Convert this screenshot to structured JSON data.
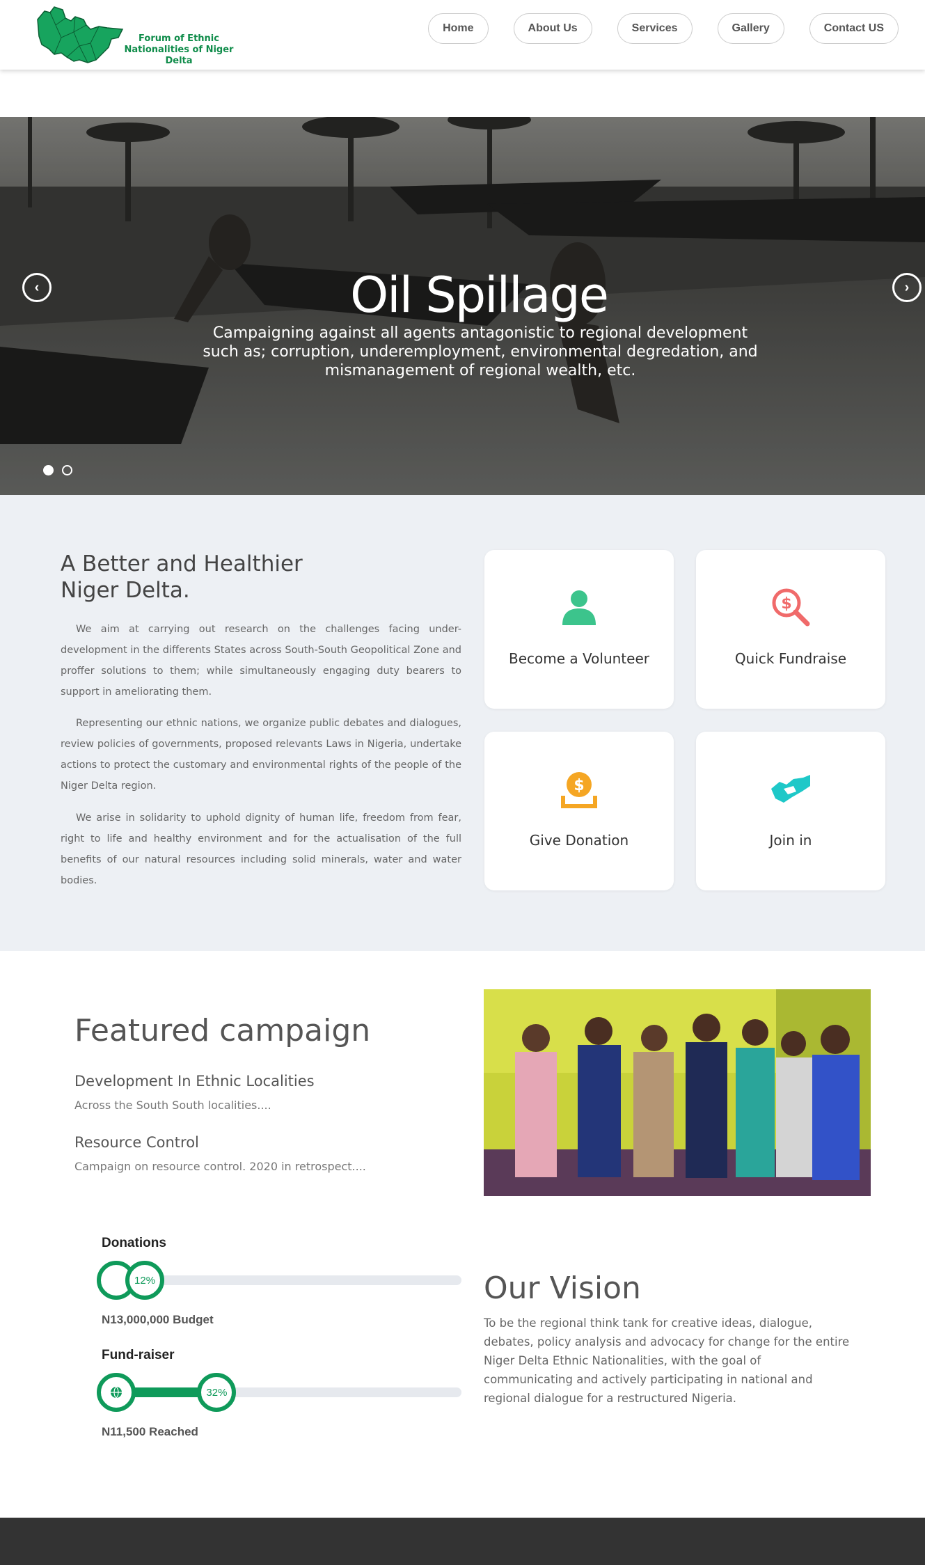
{
  "header": {
    "logo_line1": "Forum of Ethnic",
    "logo_line2": "Nationalities of Niger Delta",
    "nav": [
      "Home",
      "About Us",
      "Services",
      "Gallery",
      "Contact US"
    ]
  },
  "hero": {
    "title": "Oil Spillage",
    "subtitle": "Campaigning against all agents antagonistic to regional development such as; corruption, underemployment, environmental degredation, and mismanagement of regional wealth, etc.",
    "slide_count": 2,
    "active_slide": 1
  },
  "about": {
    "title": "A Better and Healthier Niger Delta.",
    "paragraphs": [
      "We aim at carrying out research on the challenges facing under-development in the differents States across South-South Geopolitical Zone and proffer solutions to them; while simultaneously engaging duty bearers to support in ameliorating them.",
      "Representing our ethnic nations, we organize public debates and dialogues, review policies of governments, proposed relevants Laws in Nigeria, undertake actions to protect the customary and environmental rights of the people of the Niger Delta region.",
      "We arise in solidarity to uphold dignity of human life, freedom from fear, right to life and healthy environment and for the actualisation of the full benefits of our natural resources including solid minerals, water and water bodies."
    ],
    "cards": [
      {
        "label": "Become a Volunteer",
        "icon": "user-icon"
      },
      {
        "label": "Quick Fundraise",
        "icon": "money-search-icon"
      },
      {
        "label": "Give Donation",
        "icon": "donation-icon"
      },
      {
        "label": "Join in",
        "icon": "handshake-icon"
      }
    ]
  },
  "featured": {
    "title": "Featured campaign",
    "items": [
      {
        "title": "Development In Ethnic Localities",
        "desc": "Across the South South localities...."
      },
      {
        "title": "Resource Control",
        "desc": "Campaign on resource control. 2020 in retrospect...."
      }
    ]
  },
  "progress": [
    {
      "label": "Donations",
      "percent_text": "12%",
      "percent": 12,
      "note": "N13,000,000 Budget"
    },
    {
      "label": "Fund-raiser",
      "percent_text": "32%",
      "percent": 32,
      "note": "N11,500 Reached"
    }
  ],
  "vision": {
    "title": "Our Vision",
    "text": "To be the regional think tank for creative ideas, dialogue, debates, policy analysis and advocacy for change for the entire Niger Delta Ethnic Nationalities, with the goal of communicating and actively participating in national and regional dialogue for a restructured Nigeria."
  },
  "colors": {
    "brand_green": "#0f9a5a",
    "icon_green": "#3cc48c",
    "icon_red": "#f06a6a",
    "icon_orange": "#f5a623",
    "icon_teal": "#1ec8c8",
    "section_bg": "#edf0f4",
    "footer_bg": "#333333"
  }
}
